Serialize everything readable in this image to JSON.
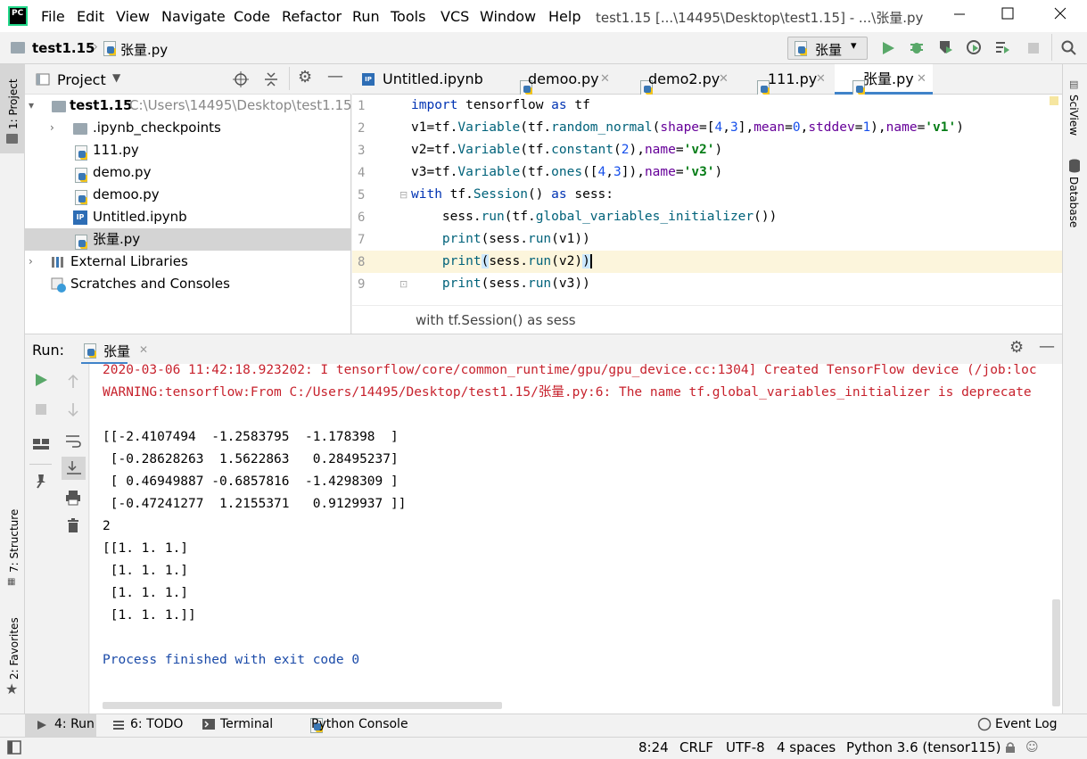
{
  "app": {
    "logo_text": "PC",
    "window_title": "test1.15 [...\\14495\\Desktop\\test1.15] - ...\\张量.py"
  },
  "menu": [
    "File",
    "Edit",
    "View",
    "Navigate",
    "Code",
    "Refactor",
    "Run",
    "Tools",
    "VCS",
    "Window",
    "Help"
  ],
  "navbar": {
    "project": "test1.15",
    "file": "张量.py",
    "run_config": "张量"
  },
  "left_stripe": {
    "project_tab": "1: Project",
    "structure_tab": "7: Structure",
    "favorites_tab": "2: Favorites"
  },
  "right_stripe": {
    "sciview_tab": "SciView",
    "database_tab": "Database"
  },
  "project_panel": {
    "title": "Project",
    "root": {
      "name": "test1.15",
      "path": "C:\\Users\\14495\\Desktop\\test1.15"
    },
    "items": [
      ".ipynb_checkpoints",
      "111.py",
      "demo.py",
      "demoo.py",
      "Untitled.ipynb",
      "张量.py"
    ],
    "external": "External Libraries",
    "scratches": "Scratches and Consoles"
  },
  "editor": {
    "tabs": [
      "Untitled.ipynb",
      "demoo.py",
      "demo2.py",
      "111.py",
      "张量.py"
    ],
    "active_tab": "张量.py",
    "line_numbers": [
      "1",
      "2",
      "3",
      "4",
      "5",
      "6",
      "7",
      "8",
      "9"
    ],
    "breadcrumb": "with tf.Session() as sess"
  },
  "run_panel": {
    "label": "Run:",
    "tab": "张量",
    "console": [
      "2020-03-06 11:42:18.923202: I tensorflow/core/common_runtime/gpu/gpu_device.cc:1304] Created TensorFlow device (/job:loc",
      "WARNING:tensorflow:From C:/Users/14495/Desktop/test1.15/张量.py:6: The name tf.global_variables_initializer is deprecate",
      "",
      "[[-2.4107494  -1.2583795  -1.178398  ]",
      " [-0.28628263  1.5622863   0.28495237]",
      " [ 0.46949887 -0.6857816  -1.4298309 ]",
      " [-0.47241277  1.2155371   0.9129937 ]]",
      "2",
      "[[1. 1. 1.]",
      " [1. 1. 1.]",
      " [1. 1. 1.]",
      " [1. 1. 1.]]",
      "",
      "Process finished with exit code 0"
    ]
  },
  "bottom_tabs": {
    "run": "4: Run",
    "todo": "6: TODO",
    "terminal": "Terminal",
    "python_console": "Python Console",
    "event_log": "Event Log"
  },
  "status_bar": {
    "position": "8:24",
    "line_sep": "CRLF",
    "encoding": "UTF-8",
    "indent": "4 spaces",
    "interpreter": "Python 3.6 (tensor115)"
  },
  "colors": {
    "keyword": "#0033b3",
    "error_text": "#c7222d",
    "run_green": "#59a869",
    "tab_underline": "#4083c9"
  }
}
